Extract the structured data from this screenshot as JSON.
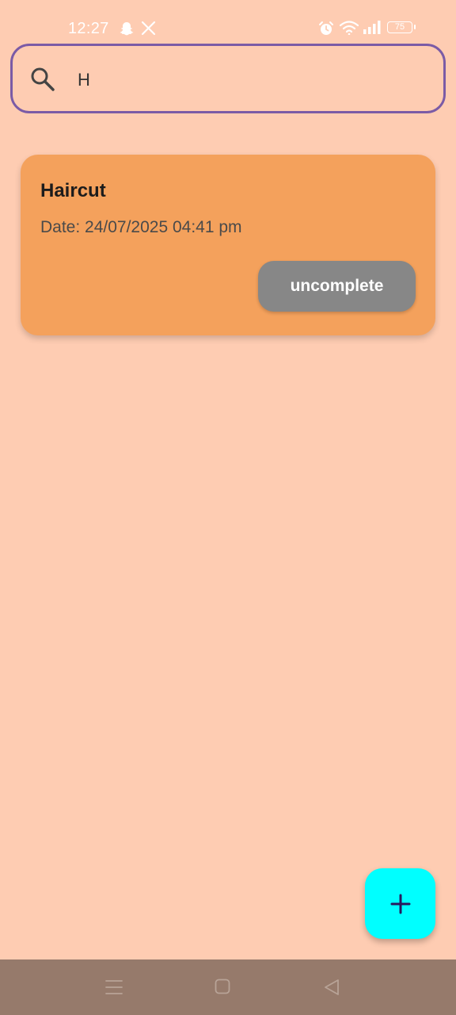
{
  "status_bar": {
    "time": "12:27",
    "battery": "75",
    "icons": [
      "snapchat-icon",
      "x-icon",
      "alarm-icon",
      "wifi-icon",
      "signal-icon",
      "battery-icon"
    ]
  },
  "search": {
    "value": "H",
    "icon": "search-icon",
    "border_color": "#7B5BA6"
  },
  "tasks": [
    {
      "title": "Haircut",
      "date": "Date: 24/07/2025 04:41 pm",
      "status_label": "uncomplete",
      "card_color": "#F4A15C",
      "button_color": "#878787"
    }
  ],
  "fab": {
    "icon": "plus-icon",
    "color": "#00FFFF"
  },
  "nav_bar": {
    "icons": [
      "menu-icon",
      "home-icon",
      "back-icon"
    ],
    "color": "#967A6B"
  },
  "colors": {
    "background": "#FECCB2"
  }
}
